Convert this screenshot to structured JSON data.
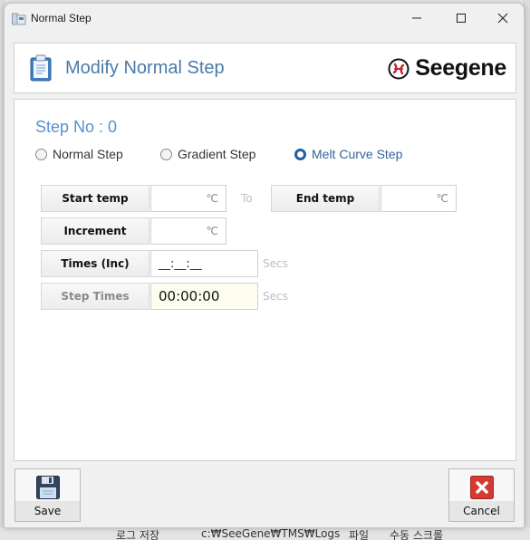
{
  "window": {
    "title": "Normal Step",
    "controls": {
      "minimize": "minimize",
      "maximize": "maximize",
      "close": "close"
    }
  },
  "header": {
    "title": "Modify Normal Step",
    "icon": "clipboard-icon",
    "brand": "Seegene",
    "brand_colors": {
      "mark": "#c0262d",
      "text": "#111111"
    }
  },
  "form": {
    "step_no_label": "Step No : 0",
    "step_type": {
      "options": [
        "Normal Step",
        "Gradient Step",
        "Melt Curve Step"
      ],
      "selected": "Melt Curve Step"
    },
    "fields": {
      "start_temp": {
        "label": "Start temp",
        "value": "",
        "unit": "℃"
      },
      "to_label": "To",
      "end_temp": {
        "label": "End temp",
        "value": "",
        "unit": "℃"
      },
      "increment": {
        "label": "Increment",
        "value": "",
        "unit": "℃"
      },
      "times_inc": {
        "label": "Times (Inc)",
        "value": "__:__:__",
        "unit": "Secs"
      },
      "step_times": {
        "label": "Step Times",
        "value": "00:00:00",
        "unit": "Secs"
      }
    }
  },
  "buttons": {
    "save": {
      "label": "Save",
      "icon": "floppy-disk-icon"
    },
    "cancel": {
      "label": "Cancel",
      "icon": "red-x-icon"
    }
  },
  "background_app": {
    "bottom_strip": [
      "로그 저장",
      "c:₩SeeGene₩TMS₩Logs",
      "파일",
      "수동 스크롤"
    ]
  },
  "colors": {
    "accent_blue": "#4a7ba7",
    "step_no_blue": "#5b8fd0",
    "radio_selected": "#1f5fa8",
    "readonly_field_bg": "#fdfdf0",
    "cancel_red": "#d23a32"
  }
}
